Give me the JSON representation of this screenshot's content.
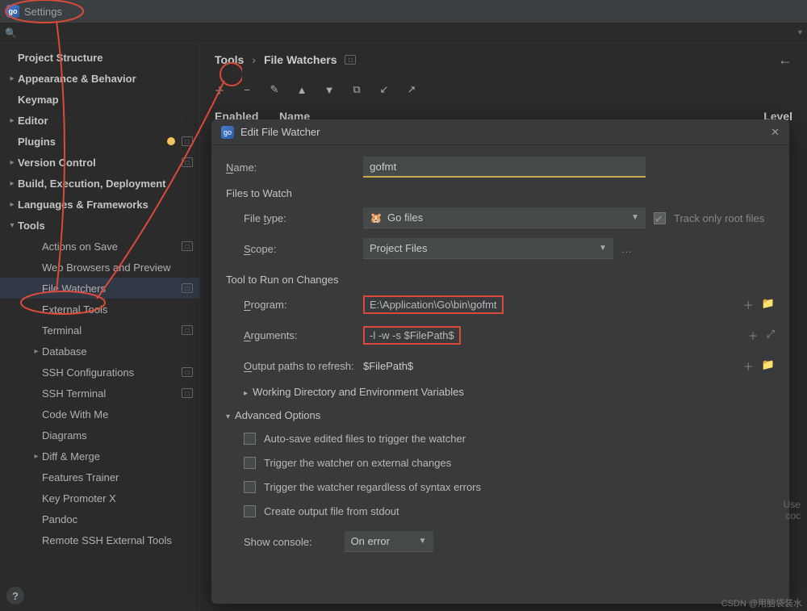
{
  "window": {
    "title": "Settings"
  },
  "sidebar": {
    "items": [
      {
        "label": "Project Structure",
        "caret": "",
        "sub": 0,
        "sel": 0,
        "tag": 0,
        "dot": 0
      },
      {
        "label": "Appearance & Behavior",
        "caret": "▸",
        "sub": 0,
        "sel": 0,
        "tag": 0,
        "dot": 0
      },
      {
        "label": "Keymap",
        "caret": "",
        "sub": 0,
        "sel": 0,
        "tag": 0,
        "dot": 0
      },
      {
        "label": "Editor",
        "caret": "▸",
        "sub": 0,
        "sel": 0,
        "tag": 0,
        "dot": 0
      },
      {
        "label": "Plugins",
        "caret": "",
        "sub": 0,
        "sel": 0,
        "tag": 1,
        "dot": 1
      },
      {
        "label": "Version Control",
        "caret": "▸",
        "sub": 0,
        "sel": 0,
        "tag": 1,
        "dot": 0
      },
      {
        "label": "Build, Execution, Deployment",
        "caret": "▸",
        "sub": 0,
        "sel": 0,
        "tag": 0,
        "dot": 0
      },
      {
        "label": "Languages & Frameworks",
        "caret": "▸",
        "sub": 0,
        "sel": 0,
        "tag": 0,
        "dot": 0
      },
      {
        "label": "Tools",
        "caret": "▾",
        "sub": 0,
        "sel": 0,
        "tag": 0,
        "dot": 0
      },
      {
        "label": "Actions on Save",
        "caret": "",
        "sub": 1,
        "sel": 0,
        "tag": 1,
        "dot": 0
      },
      {
        "label": "Web Browsers and Preview",
        "caret": "",
        "sub": 1,
        "sel": 0,
        "tag": 0,
        "dot": 0
      },
      {
        "label": "File Watchers",
        "caret": "",
        "sub": 1,
        "sel": 1,
        "tag": 1,
        "dot": 0
      },
      {
        "label": "External Tools",
        "caret": "",
        "sub": 1,
        "sel": 0,
        "tag": 0,
        "dot": 0
      },
      {
        "label": "Terminal",
        "caret": "",
        "sub": 1,
        "sel": 0,
        "tag": 1,
        "dot": 0
      },
      {
        "label": "Database",
        "caret": "▸",
        "sub": 1,
        "sel": 0,
        "tag": 0,
        "dot": 0
      },
      {
        "label": "SSH Configurations",
        "caret": "",
        "sub": 1,
        "sel": 0,
        "tag": 1,
        "dot": 0
      },
      {
        "label": "SSH Terminal",
        "caret": "",
        "sub": 1,
        "sel": 0,
        "tag": 1,
        "dot": 0
      },
      {
        "label": "Code With Me",
        "caret": "",
        "sub": 1,
        "sel": 0,
        "tag": 0,
        "dot": 0
      },
      {
        "label": "Diagrams",
        "caret": "",
        "sub": 1,
        "sel": 0,
        "tag": 0,
        "dot": 0
      },
      {
        "label": "Diff & Merge",
        "caret": "▸",
        "sub": 1,
        "sel": 0,
        "tag": 0,
        "dot": 0
      },
      {
        "label": "Features Trainer",
        "caret": "",
        "sub": 1,
        "sel": 0,
        "tag": 0,
        "dot": 0
      },
      {
        "label": "Key Promoter X",
        "caret": "",
        "sub": 1,
        "sel": 0,
        "tag": 0,
        "dot": 0
      },
      {
        "label": "Pandoc",
        "caret": "",
        "sub": 1,
        "sel": 0,
        "tag": 0,
        "dot": 0
      },
      {
        "label": "Remote SSH External Tools",
        "caret": "",
        "sub": 1,
        "sel": 0,
        "tag": 0,
        "dot": 0
      }
    ]
  },
  "breadcrumb": {
    "seg1": "Tools",
    "seg2": "File Watchers"
  },
  "columns": {
    "enabled": "Enabled",
    "name": "Name",
    "level": "Level"
  },
  "dialog": {
    "title": "Edit File Watcher",
    "name_label": "Name:",
    "name_value": "gofmt",
    "section_files": "Files to Watch",
    "filetype_label": "File type:",
    "filetype_value": "Go files",
    "track_only": "Track only root files",
    "scope_label": "Scope:",
    "scope_value": "Project Files",
    "section_tool": "Tool to Run on Changes",
    "program_label": "Program:",
    "program_value": "E:\\Application\\Go\\bin\\gofmt",
    "arguments_label": "Arguments:",
    "arguments_value": "-l -w -s $FilePath$",
    "output_label": "Output paths to refresh:",
    "output_value": "$FilePath$",
    "wd_env": "Working Directory and Environment Variables",
    "section_adv": "Advanced Options",
    "opts": [
      "Auto-save edited files to trigger the watcher",
      "Trigger the watcher on external changes",
      "Trigger the watcher regardless of syntax errors",
      "Create output file from stdout"
    ],
    "show_console_label": "Show console:",
    "show_console_value": "On error"
  },
  "hint": {
    "use": "Use",
    "coc": "coc"
  },
  "watermark": "CSDN @用脑袋装水"
}
